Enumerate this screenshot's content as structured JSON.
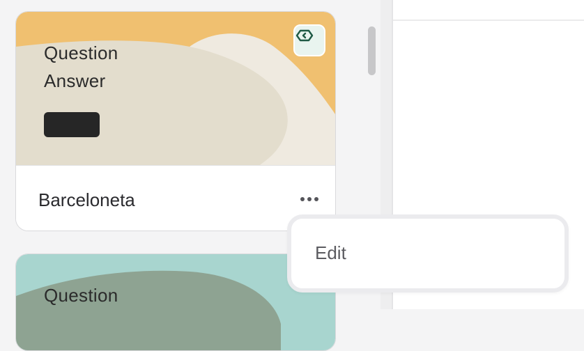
{
  "cards": [
    {
      "question": "Question",
      "answer": "Answer",
      "name": "Barceloneta",
      "colors": {
        "top": "#f0c070",
        "blob_light": "#efeae0",
        "blob_main": "#e3ddcd",
        "pill": "#262626"
      }
    },
    {
      "question": "Question",
      "colors": {
        "top": "#a8d5cf",
        "blob_main": "#8ea392"
      }
    }
  ],
  "context_menu": {
    "items": [
      {
        "label": "Edit"
      }
    ]
  },
  "icons": {
    "tag": "tag-icon",
    "more": "more-horizontal-icon"
  }
}
